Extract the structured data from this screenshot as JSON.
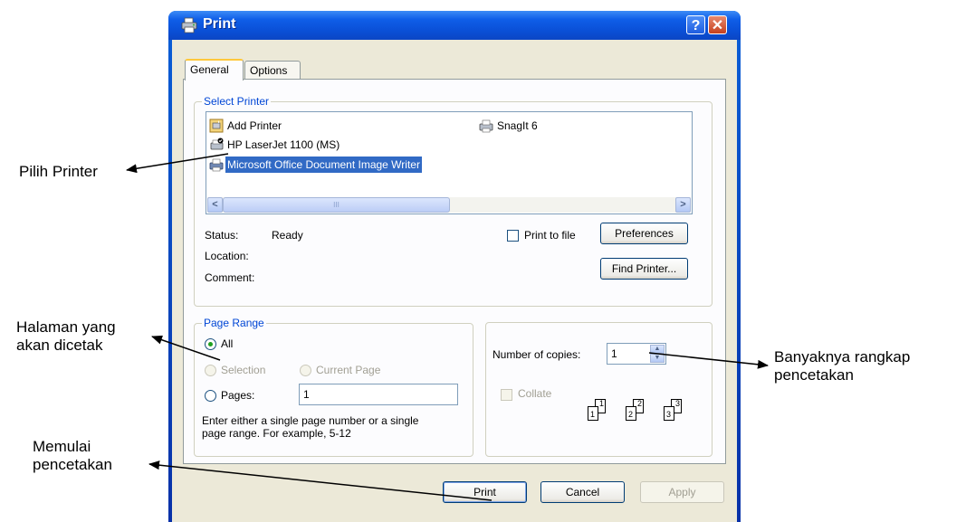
{
  "window": {
    "title": "Print",
    "help_glyph": "?",
    "close_glyph": "✕"
  },
  "tabs": [
    {
      "label": "General",
      "active": true
    },
    {
      "label": "Options",
      "active": false
    }
  ],
  "select_printer": {
    "group_title": "Select Printer",
    "printers": [
      {
        "label": "Add Printer",
        "icon": "add-printer-icon",
        "selected": false
      },
      {
        "label": "HP LaserJet 1100 (MS)",
        "icon": "default-printer-icon",
        "selected": false
      },
      {
        "label": "Microsoft Office Document Image Writer",
        "icon": "printer-icon",
        "selected": true
      },
      {
        "label": "SnagIt 6",
        "icon": "printer-icon",
        "selected": false
      }
    ],
    "scroll_left": "<",
    "scroll_right": ">",
    "scroll_thumb_grip": "III",
    "status_label": "Status:",
    "status_value": "Ready",
    "location_label": "Location:",
    "comment_label": "Comment:",
    "print_to_file_label": "Print to file",
    "preferences_button": "Preferences",
    "find_printer_button": "Find Printer..."
  },
  "page_range": {
    "group_title": "Page Range",
    "all_label": "All",
    "selection_label": "Selection",
    "current_page_label": "Current Page",
    "pages_label": "Pages:",
    "pages_value": "1",
    "hint_line1": "Enter either a single page number or a single",
    "hint_line2": "page range.  For example, 5-12"
  },
  "copies": {
    "number_label": "Number of copies:",
    "number_value": "1",
    "collate_label": "Collate",
    "collate_pages": [
      {
        "back": "1",
        "front": "1"
      },
      {
        "back": "2",
        "front": "2"
      },
      {
        "back": "3",
        "front": "3"
      }
    ]
  },
  "buttons": {
    "print": "Print",
    "cancel": "Cancel",
    "apply": "Apply"
  },
  "annotations": {
    "pilih_printer": "Pilih Printer",
    "halaman_line1": "Halaman yang",
    "halaman_line2": "akan dicetak",
    "memulai_line1": "Memulai",
    "memulai_line2": "pencetakan",
    "banyaknya_line1": "Banyaknya rangkap",
    "banyaknya_line2": "pencetakan"
  }
}
